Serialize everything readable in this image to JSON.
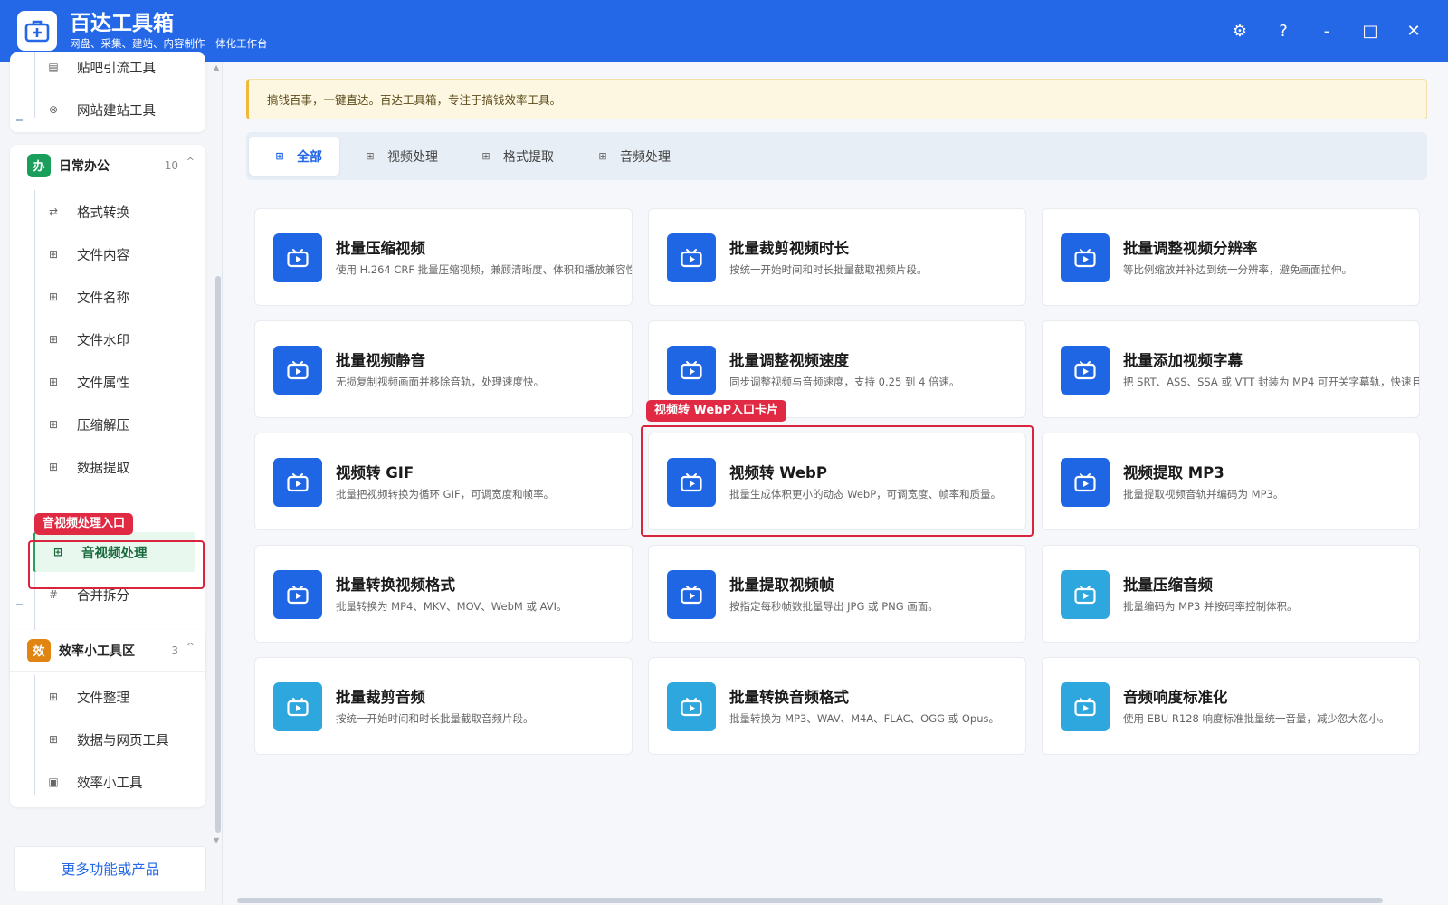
{
  "app": {
    "title": "百达工具箱",
    "subtitle": "网盘、采集、建站、内容制作一体化工作台"
  },
  "window_controls": {
    "settings": "⚙",
    "help": "?",
    "minimize": "-",
    "maximize": "□",
    "close": "✕"
  },
  "sidebar": {
    "top_group_items": [
      {
        "label": "贴吧引流工具",
        "icon": "post-icon"
      },
      {
        "label": "网站建站工具",
        "icon": "globe-icon"
      }
    ],
    "office_group": {
      "badge": "办",
      "badge_color": "#1a9e5c",
      "name": "日常办公",
      "count": "10",
      "items": [
        {
          "label": "格式转换",
          "icon": "swap-icon"
        },
        {
          "label": "文件内容",
          "icon": "grid-icon"
        },
        {
          "label": "文件名称",
          "icon": "grid-icon"
        },
        {
          "label": "文件水印",
          "icon": "grid-icon"
        },
        {
          "label": "文件属性",
          "icon": "grid-icon"
        },
        {
          "label": "压缩解压",
          "icon": "grid-icon"
        },
        {
          "label": "数据提取",
          "icon": "grid-icon"
        },
        {
          "label": "音视频处理",
          "icon": "grid-icon",
          "active": true
        },
        {
          "label": "合并拆分",
          "icon": "hash-icon"
        }
      ]
    },
    "efficiency_group": {
      "badge": "效",
      "badge_color": "#e08412",
      "name": "效率小工具区",
      "count": "3",
      "items": [
        {
          "label": "文件整理",
          "icon": "grid-icon"
        },
        {
          "label": "数据与网页工具",
          "icon": "grid-icon"
        },
        {
          "label": "效率小工具",
          "icon": "toolbox-icon"
        }
      ]
    },
    "more_button": "更多功能或产品"
  },
  "annotations": {
    "sidebar_tag": "音视频处理入口",
    "card_tag": "视频转 WebP入口卡片"
  },
  "notice": "搞钱百事，一键直达。百达工具箱，专注于搞钱效率工具。",
  "tabs": [
    {
      "label": "全部",
      "active": true
    },
    {
      "label": "视频处理"
    },
    {
      "label": "格式提取"
    },
    {
      "label": "音频处理"
    }
  ],
  "colors": {
    "accent": "#2468e8",
    "video_icon": "#1f66e5",
    "audio_icon": "#2ea6de",
    "highlight": "#d8253d"
  },
  "cards": [
    {
      "title": "批量压缩视频",
      "desc": "使用 H.264 CRF 批量压缩视频，兼顾清晰度、体积和播放兼容性。",
      "kind": "video"
    },
    {
      "title": "批量裁剪视频时长",
      "desc": "按统一开始时间和时长批量截取视频片段。",
      "kind": "video"
    },
    {
      "title": "批量调整视频分辨率",
      "desc": "等比例缩放并补边到统一分辨率，避免画面拉伸。",
      "kind": "video"
    },
    {
      "title": "批量视频静音",
      "desc": "无损复制视频画面并移除音轨，处理速度快。",
      "kind": "video"
    },
    {
      "title": "批量调整视频速度",
      "desc": "同步调整视频与音频速度，支持 0.25 到 4 倍速。",
      "kind": "video"
    },
    {
      "title": "批量添加视频字幕",
      "desc": "把 SRT、ASS、SSA 或 VTT 封装为 MP4 可开关字幕轨，快速且不重",
      "kind": "video"
    },
    {
      "title": "视频转 GIF",
      "desc": "批量把视频转换为循环 GIF，可调宽度和帧率。",
      "kind": "video"
    },
    {
      "title": "视频转 WebP",
      "desc": "批量生成体积更小的动态 WebP，可调宽度、帧率和质量。",
      "kind": "video",
      "highlighted": true
    },
    {
      "title": "视频提取 MP3",
      "desc": "批量提取视频音轨并编码为 MP3。",
      "kind": "video"
    },
    {
      "title": "批量转换视频格式",
      "desc": "批量转换为 MP4、MKV、MOV、WebM 或 AVI。",
      "kind": "video"
    },
    {
      "title": "批量提取视频帧",
      "desc": "按指定每秒帧数批量导出 JPG 或 PNG 画面。",
      "kind": "video"
    },
    {
      "title": "批量压缩音频",
      "desc": "批量编码为 MP3 并按码率控制体积。",
      "kind": "audio"
    },
    {
      "title": "批量裁剪音频",
      "desc": "按统一开始时间和时长批量截取音频片段。",
      "kind": "audio"
    },
    {
      "title": "批量转换音频格式",
      "desc": "批量转换为 MP3、WAV、M4A、FLAC、OGG 或 Opus。",
      "kind": "audio"
    },
    {
      "title": "音频响度标准化",
      "desc": "使用 EBU R128 响度标准批量统一音量，减少忽大忽小。",
      "kind": "audio"
    }
  ]
}
